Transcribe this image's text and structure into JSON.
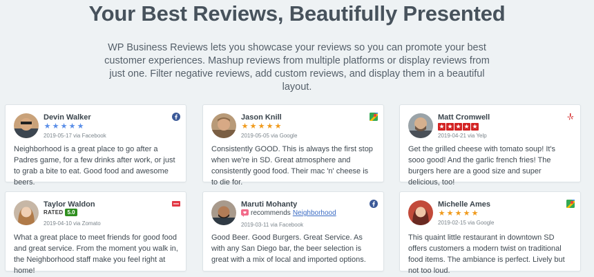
{
  "header": {
    "title": "Your Best Reviews, Beautifully Presented",
    "intro": "WP Business Reviews lets you showcase your reviews so you can promote your best customer experiences. Mashup reviews from multiple platforms or display reviews from just one. Filter negative reviews, add custom reviews, and display them in a beautiful layout."
  },
  "colors": {
    "facebook": "#3b5998",
    "google_stars": "#f09a1c",
    "yelp": "#d32323",
    "zomato": "#e23744",
    "zomato_rating": "#2f8f1f"
  },
  "reviews": [
    {
      "name": "Devin Walker",
      "meta": "2019-05-17 via Facebook",
      "rating": 5,
      "platform_icon": "facebook-icon",
      "text": "Neighborhood is a great place to go after a Padres game, for a few drinks after work, or just to grab a bite to eat. Good food and awesome beers."
    },
    {
      "name": "Jason Knill",
      "meta": "2019-05-05 via Google",
      "rating": 5,
      "platform_icon": "google-maps-icon",
      "text": "Consistently GOOD. This is always the first stop when we're in SD. Great atmosphere and consistently good food. Their mac 'n' cheese is to die for."
    },
    {
      "name": "Matt Cromwell",
      "meta": "2019-04-21 via Yelp",
      "rating": 5,
      "platform_icon": "yelp-icon",
      "text": "Get the grilled cheese with tomato soup! It's sooo good! And the garlic french fries! The burgers here are a good size and super delicious, too!"
    },
    {
      "name": "Taylor Waldon",
      "rated_label": "RATED",
      "rated_score": "5.0",
      "meta": "2019-04-10 via Zomato",
      "platform_icon": "zomato-icon",
      "text": "What a great place to meet friends for good food and great service. From the moment you walk in, the Neighborhood staff make you feel right at home!"
    },
    {
      "name": "Maruti Mohanty",
      "recommends": "recommends",
      "recommends_link": "Neighborhood",
      "meta": "2019-03-11 via Facebook",
      "platform_icon": "facebook-icon",
      "text": "Good Beer. Good Burgers. Great Service. As with any San Diego bar, the beer selection is great with a mix of local and imported options."
    },
    {
      "name": "Michelle Ames",
      "meta": "2019-02-15 via Google",
      "rating": 5,
      "platform_icon": "google-maps-icon",
      "text": "This quaint little restaurant in downtown SD offers customers a modern twist on traditional food items. The ambiance is perfect. Lively but not too loud."
    }
  ]
}
